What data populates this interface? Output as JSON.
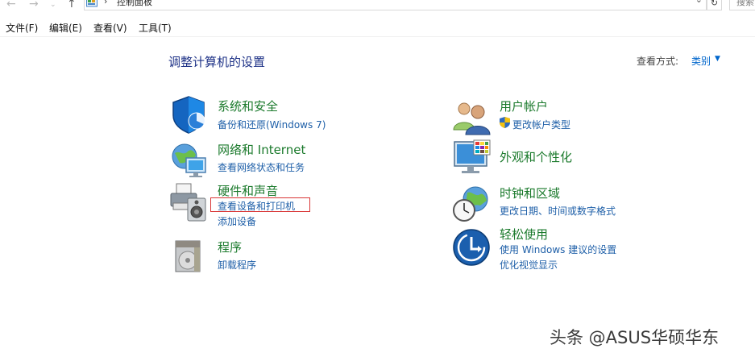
{
  "address_bar": {
    "path_label": "控制面板",
    "separator": "›",
    "search_placeholder": "搜索"
  },
  "menu": {
    "items": [
      "文件(F)",
      "编辑(E)",
      "查看(V)",
      "工具(T)"
    ]
  },
  "header": {
    "title": "调整计算机的设置",
    "view_by_label": "查看方式:",
    "view_by_value": "类别"
  },
  "categories": {
    "system_security": {
      "title": "系统和安全",
      "links": [
        "备份和还原(Windows 7)"
      ]
    },
    "network": {
      "title": "网络和 Internet",
      "links": [
        "查看网络状态和任务"
      ]
    },
    "hardware": {
      "title": "硬件和声音",
      "links": [
        "查看设备和打印机",
        "添加设备"
      ]
    },
    "programs": {
      "title": "程序",
      "links": [
        "卸载程序"
      ]
    },
    "user_accounts": {
      "title": "用户帐户",
      "links": [
        "更改帐户类型"
      ]
    },
    "appearance": {
      "title": "外观和个性化",
      "links": []
    },
    "clock_region": {
      "title": "时钟和区域",
      "links": [
        "更改日期、时间或数字格式"
      ]
    },
    "ease_of_access": {
      "title": "轻松使用",
      "links": [
        "使用 Windows 建议的设置",
        "优化视觉显示"
      ]
    }
  },
  "watermark": "头条 @ASUS华硕华东",
  "colors": {
    "link": "#1e5fa8",
    "category_title": "#1b7a2c",
    "page_title": "#1e3287",
    "highlight": "#d93636"
  }
}
